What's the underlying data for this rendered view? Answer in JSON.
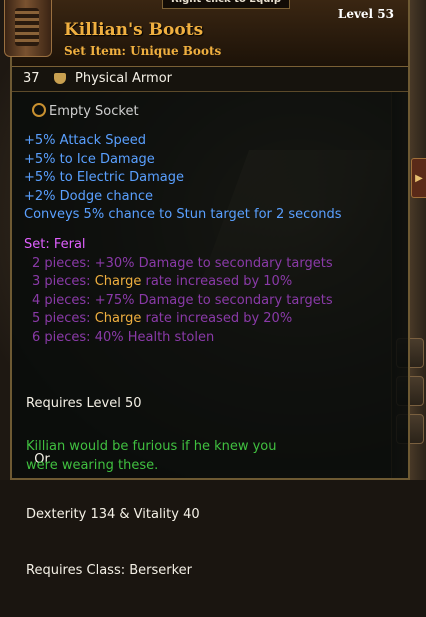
{
  "item": {
    "equip_hint": "Right-click to Equip",
    "name": "Killian's Boots",
    "subtitle": "Set Item: Unique Boots",
    "level": "Level 53",
    "armor_value": "37",
    "armor_label": "Physical Armor",
    "socket": "Empty Socket",
    "stats": [
      "+5% Attack Speed",
      "+5% to Ice Damage",
      "+5% to Electric Damage",
      "+2% Dodge chance",
      "Conveys 5% chance to Stun target for 2 seconds"
    ],
    "set": {
      "title": "Set: Feral",
      "bonuses": [
        {
          "pre": "2 pieces: +30% Damage to secondary targets",
          "highlight": "",
          "post": ""
        },
        {
          "pre": "3 pieces: ",
          "highlight": "Charge",
          "post": " rate increased by 10%"
        },
        {
          "pre": "4 pieces: +75% Damage to secondary targets",
          "highlight": "",
          "post": ""
        },
        {
          "pre": "5 pieces: ",
          "highlight": "Charge",
          "post": " rate increased by 20%"
        },
        {
          "pre": "6 pieces: 40% Health stolen",
          "highlight": "",
          "post": ""
        }
      ]
    },
    "requirements": [
      "Requires Level 50",
      "  Or",
      "Dexterity 134 & Vitality 40",
      "Requires Class: Berserker"
    ],
    "flavor": [
      "Killian would be furious if he knew you",
      "were wearing these."
    ]
  },
  "colors": {
    "name": "#f0b040",
    "magic_stat": "#5aa0ff",
    "set_title": "#e060ff",
    "set_inactive": "#8a3aa8",
    "flavor": "#40c040"
  }
}
